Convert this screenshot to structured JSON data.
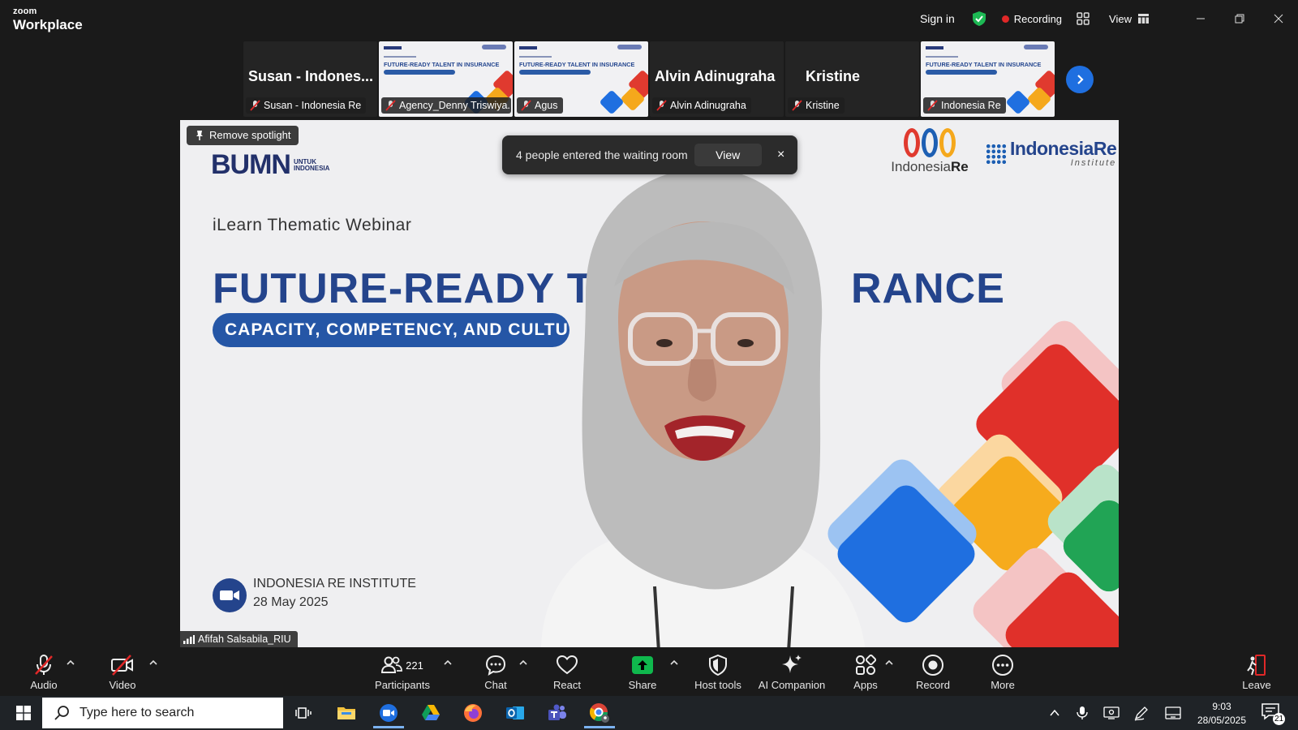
{
  "titlebar": {
    "brand_top": "zoom",
    "brand_bottom": "Workplace",
    "sign_in": "Sign in",
    "recording": "Recording",
    "view": "View"
  },
  "strip": {
    "thumbs": [
      {
        "type": "name",
        "title": "Susan - Indones...",
        "label": "Susan - Indonesia Re"
      },
      {
        "type": "slide",
        "slide_title": "FUTURE-READY TALENT IN INSURANCE",
        "label": "Agency_Denny Triswiya..."
      },
      {
        "type": "slide",
        "slide_title": "FUTURE-READY TALENT IN INSURANCE",
        "label": "Agus"
      },
      {
        "type": "name",
        "title": "Alvin Adinugraha",
        "label": "Alvin Adinugraha"
      },
      {
        "type": "name",
        "title": "Kristine",
        "label": "Kristine"
      },
      {
        "type": "slide",
        "slide_title": "FUTURE-READY TALENT IN INSURANCE",
        "label": "Indonesia Re"
      }
    ]
  },
  "main": {
    "remove_spotlight": "Remove spotlight",
    "bumn_big": "BUMN",
    "bumn_small_1": "UNTUK",
    "bumn_small_2": "INDONESIA",
    "webinar": "iLearn Thematic Webinar",
    "title_left": "FUTURE-READY T",
    "title_right": "RANCE",
    "subtitle": "CAPACITY, COMPETENCY, AND CULTU",
    "institute": "INDONESIA RE INSTITUTE",
    "date": "28 May 2025",
    "ir_logo_a": "Indonesia",
    "ir_logo_b": "Re",
    "ir_inst_1": "IndonesiaRe",
    "ir_inst_2": "Institute",
    "speaker": "Afifah Salsabila_RIU"
  },
  "toast": {
    "message": "4 people entered the waiting room",
    "view": "View",
    "close": "×"
  },
  "toolbar": {
    "audio": "Audio",
    "video": "Video",
    "participants": "Participants",
    "participants_count": "221",
    "chat": "Chat",
    "react": "React",
    "share": "Share",
    "host_tools": "Host tools",
    "ai_companion": "AI Companion",
    "apps": "Apps",
    "record": "Record",
    "more": "More",
    "leave": "Leave"
  },
  "taskbar": {
    "search_placeholder": "Type here to search",
    "time": "9:03",
    "date": "28/05/2025",
    "notifications": "21"
  },
  "colors": {
    "share_green": "#0fb84d",
    "record_red": "#e02828",
    "zoom_blue": "#1f6fe0",
    "slide_navy": "#24448c"
  }
}
